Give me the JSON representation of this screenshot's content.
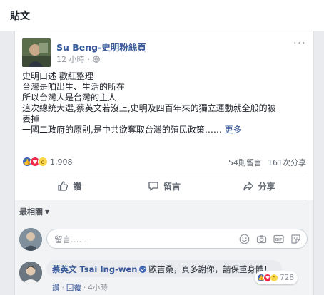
{
  "section": {
    "title": "貼文"
  },
  "post": {
    "author": "Su Beng-史明粉絲頁",
    "time": "12 小時",
    "separator": "·",
    "lines": [
      "史明口述 歡紅整理",
      "台灣是咱出生、生活的所在",
      "所以台灣人是台灣的主人",
      "這次總統大選,蔡英文若沒上,史明及四百年來的獨立運動就全般的被",
      "丟掉",
      "一國二政府的原則,是中共欲奪取台灣的殖民政策……"
    ],
    "see_more": "更多",
    "reaction_count": "1,908",
    "comments_count": "54則留言",
    "shares_count": "161次分享"
  },
  "actions": {
    "like": "讚",
    "comment": "留言",
    "share": "分享"
  },
  "comments": {
    "sort_label": "最相關",
    "input_placeholder": "留言……",
    "input_icons": [
      "emoji-icon",
      "camera-icon",
      "gif-icon",
      "sticker-icon"
    ],
    "gif_label": "GIF",
    "items": [
      {
        "author": "蔡英文 Tsai Ing-wen",
        "text": "歐吉桑，真多謝你，請保重身體！",
        "reaction_count": "728",
        "like_label": "讚",
        "reply_label": "回覆",
        "time": "4小時"
      }
    ]
  },
  "colors": {
    "link": "#385898",
    "like": "#4267b2",
    "love": "#f0284a",
    "wow": "#fcd64b"
  }
}
